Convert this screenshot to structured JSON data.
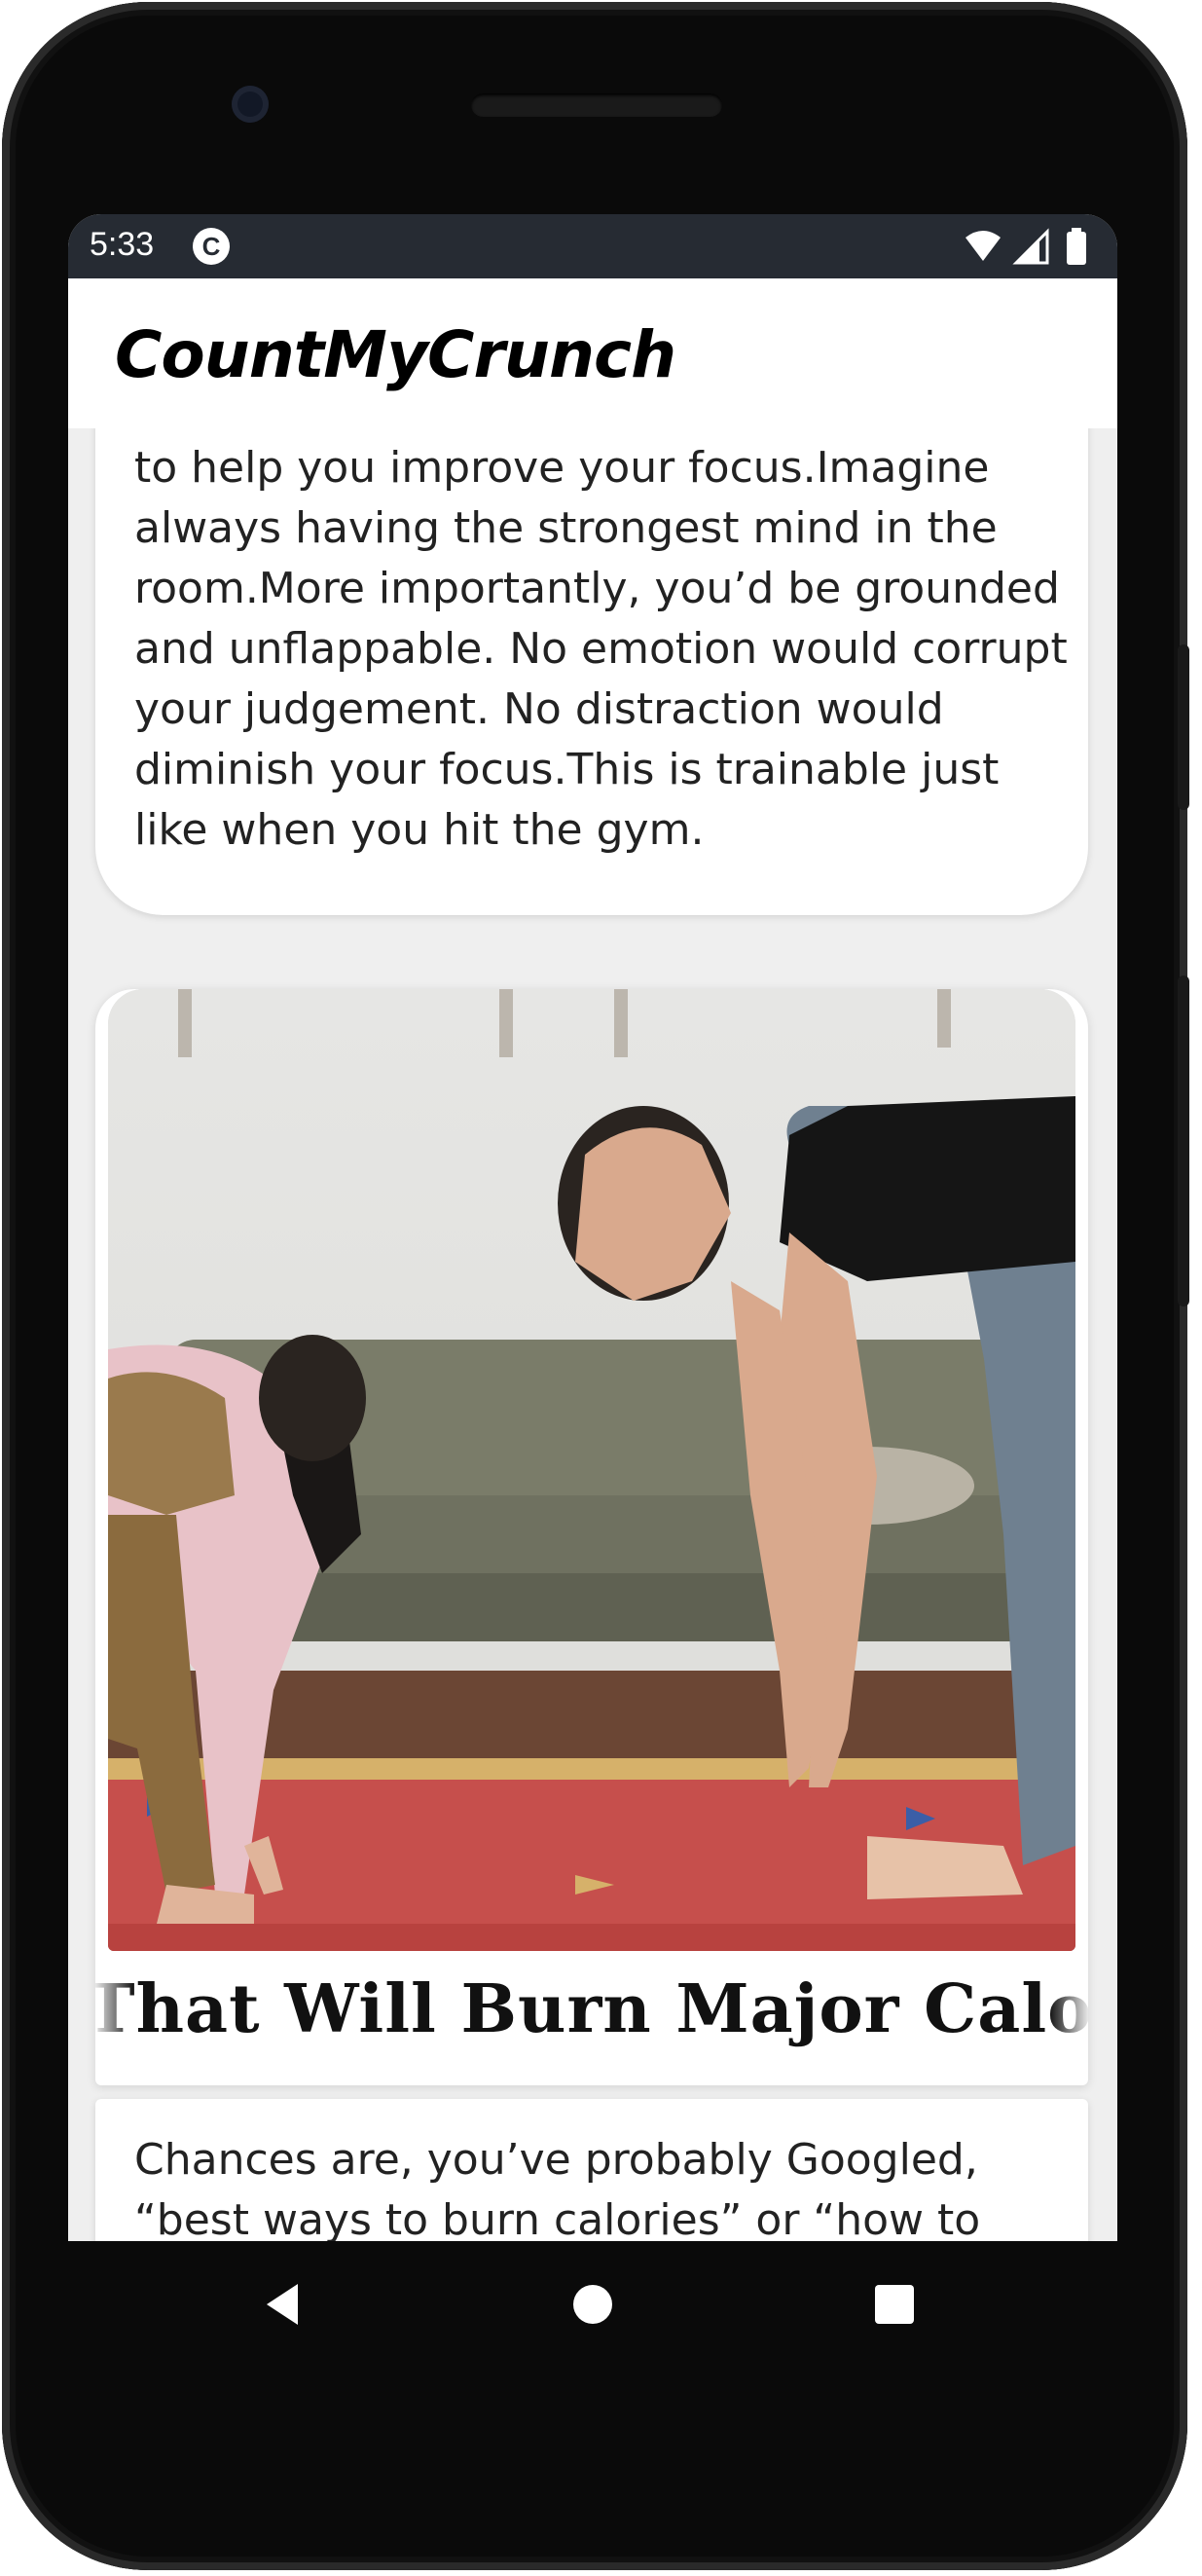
{
  "status_bar": {
    "time": "5:33",
    "app_icon": "notification-app-icon",
    "icons": [
      "wifi-icon",
      "signal-icon",
      "battery-icon"
    ]
  },
  "app_bar": {
    "title": "CountMyCrunch"
  },
  "article_card_1": {
    "body": "to help you improve your focus.Imagine always having the strongest mind in the room.More importantly, you’d be grounded and unflappable. No emotion would corrupt your judgement. No distraction would diminish your focus.This is trainable just like when you hit the gym."
  },
  "article_card_2": {
    "image": "woman-and-child-stretching-photo",
    "heading": "That Will Burn Major Calories"
  },
  "article_card_3": {
    "body": "Chances are, you’ve probably Googled, “best ways to burn calories” or “how to"
  },
  "nav_bar": {
    "buttons": [
      "back-icon",
      "home-icon",
      "recents-icon"
    ]
  },
  "colors": {
    "status_bar_bg": "#262b33",
    "app_bg": "#efefef",
    "card_bg": "#ffffff",
    "phone_body": "#0a0a0a"
  }
}
